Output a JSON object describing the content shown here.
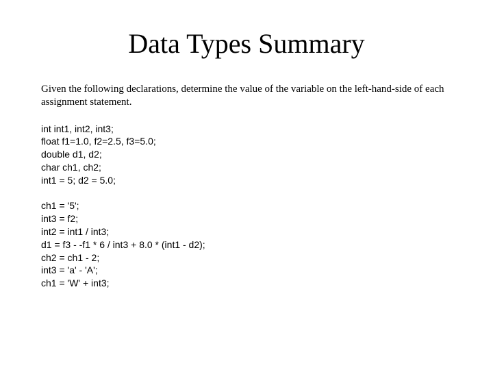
{
  "title": "Data Types Summary",
  "instruction": "Given the following declarations, determine the value of the variable on the left-hand-side of each assignment statement.",
  "decl_block": "int int1, int2, int3;\nfloat f1=1.0, f2=2.5, f3=5.0;\ndouble d1, d2;\nchar ch1, ch2;\nint1 = 5; d2 = 5.0;",
  "expr_block": "ch1 = '5';\nint3 = f2;\nint2 = int1 / int3;\nd1 = f3 - -f1 * 6 / int3 + 8.0 * (int1 - d2);\nch2 = ch1 - 2;\nint3 = 'a' - 'A';\nch1 = 'W' + int3;"
}
